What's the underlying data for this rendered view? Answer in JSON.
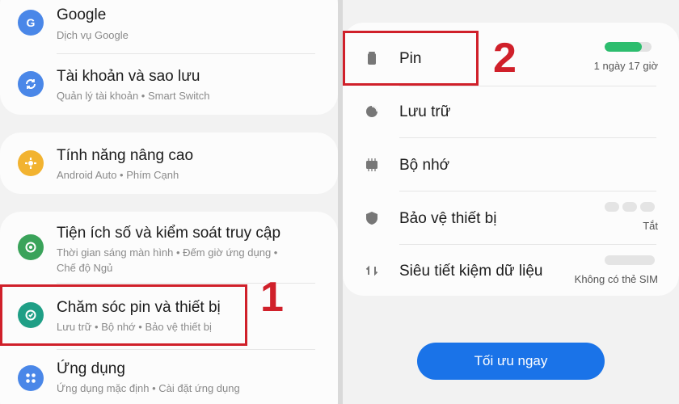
{
  "left_panel": {
    "items": [
      {
        "title": "Google",
        "subtitle": "Dịch vụ Google",
        "icon": "google-icon",
        "color": "#4a87e8"
      },
      {
        "title": "Tài khoản và sao lưu",
        "subtitle": "Quản lý tài khoản  •  Smart Switch",
        "icon": "sync-icon",
        "color": "#4a87e8"
      },
      {
        "title": "Tính năng nâng cao",
        "subtitle": "Android Auto  •  Phím Cạnh",
        "icon": "advanced-features-icon",
        "color": "#f2b330"
      },
      {
        "title": "Tiện ích số và kiểm soát truy cập",
        "subtitle": "Thời gian sáng màn hình  •  Đếm giờ ứng dụng  •  Chế độ Ngủ",
        "icon": "digital-wellbeing-icon",
        "color": "#3aa35a"
      },
      {
        "title": "Chăm sóc pin và thiết bị",
        "subtitle": "Lưu trữ  •  Bộ nhớ  •  Bảo vệ thiết bị",
        "icon": "device-care-icon",
        "color": "#1f9f86"
      },
      {
        "title": "Ứng dụng",
        "subtitle": "Ứng dụng mặc định  •  Cài đặt ứng dụng",
        "icon": "apps-icon",
        "color": "#4a87e8"
      }
    ],
    "step_label": "1"
  },
  "right_panel": {
    "items": [
      {
        "title": "Pin",
        "value": "1 ngày 17 giờ",
        "icon": "battery-icon"
      },
      {
        "title": "Lưu trữ",
        "value": "",
        "icon": "storage-icon"
      },
      {
        "title": "Bộ nhớ",
        "value": "",
        "icon": "memory-icon"
      },
      {
        "title": "Bảo vệ thiết bị",
        "value": "Tắt",
        "icon": "shield-icon"
      },
      {
        "title": "Siêu tiết kiệm dữ liệu",
        "value": "Không có thẻ SIM",
        "icon": "data-saver-icon"
      }
    ],
    "battery_level": 0.8,
    "battery_color": "#2dbd6e",
    "step_label": "2",
    "optimize_button": "Tối ưu ngay"
  },
  "accent_colors": {
    "highlight": "#d0202a",
    "button": "#1a73e8"
  }
}
